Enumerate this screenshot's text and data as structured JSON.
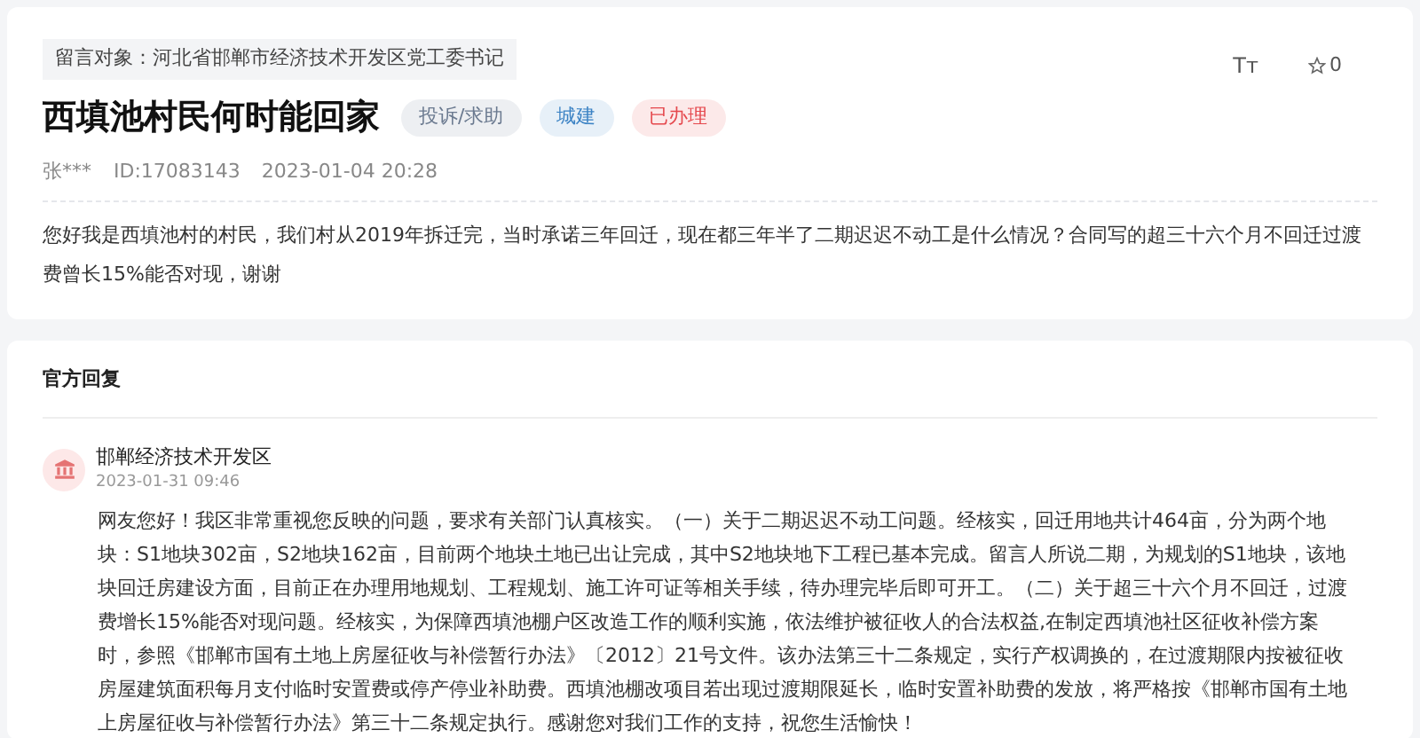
{
  "message": {
    "target": "留言对象：河北省邯郸市经济技术开发区党工委书记",
    "title": "西填池村民何时能回家",
    "tags": [
      {
        "label": "投诉/求助",
        "color": "#6b7a90"
      },
      {
        "label": "城建",
        "color": "#3b82c4"
      },
      {
        "label": "已办理",
        "color": "#e5484d"
      }
    ],
    "font_button": "Tт",
    "favorite_count": "0",
    "author": "张***",
    "id": "ID:17083143",
    "time": "2023-01-04 20:28",
    "body": "您好我是西填池村的村民，我们村从2019年拆迁完，当时承诺三年回迁，现在都三年半了二期迟迟不动工是什么情况？合同写的超三十六个月不回迁过渡费曾长15%能否对现，谢谢"
  },
  "reply": {
    "heading": "官方回复",
    "org": "邯郸经济技术开发区",
    "time": "2023-01-31 09:46",
    "body": "网友您好！我区非常重视您反映的问题，要求有关部门认真核实。（一）关于二期迟迟不动工问题。经核实，回迁用地共计464亩，分为两个地块：S1地块302亩，S2地块162亩，目前两个地块土地已出让完成，其中S2地块地下工程已基本完成。留言人所说二期，为规划的S1地块，该地块回迁房建设方面，目前正在办理用地规划、工程规划、施工许可证等相关手续，待办理完毕后即可开工。（二）关于超三十六个月不回迁，过渡费增长15%能否对现问题。经核实，为保障西填池棚户区改造工作的顺利实施，依法维护被征收人的合法权益,在制定西填池社区征收补偿方案时，参照《邯郸市国有土地上房屋征收与补偿暂行办法》〔2012〕21号文件。该办法第三十二条规定，实行产权调换的，在过渡期限内按被征收房屋建筑面积每月支付临时安置费或停产停业补助费。西填池棚改项目若出现过渡期限延长，临时安置补助费的发放，将严格按《邯郸市国有土地上房屋征收与补偿暂行办法》第三十二条规定执行。感谢您对我们工作的支持，祝您生活愉快！"
  }
}
